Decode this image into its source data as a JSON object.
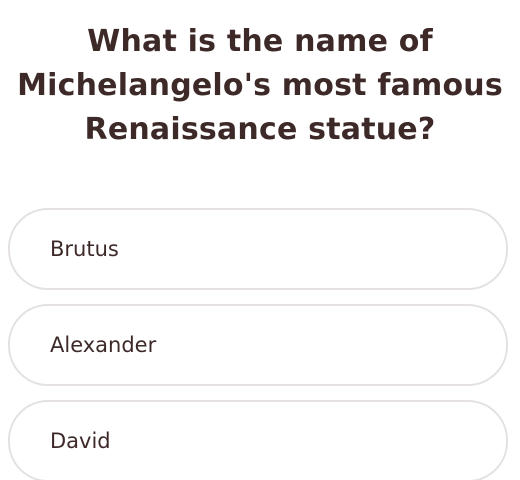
{
  "quiz": {
    "question_lines": [
      "What is the name of",
      "Michelangelo's most famous",
      "Renaissance statue?"
    ],
    "options": [
      {
        "label": "Brutus"
      },
      {
        "label": "Alexander"
      },
      {
        "label": "David"
      }
    ]
  }
}
